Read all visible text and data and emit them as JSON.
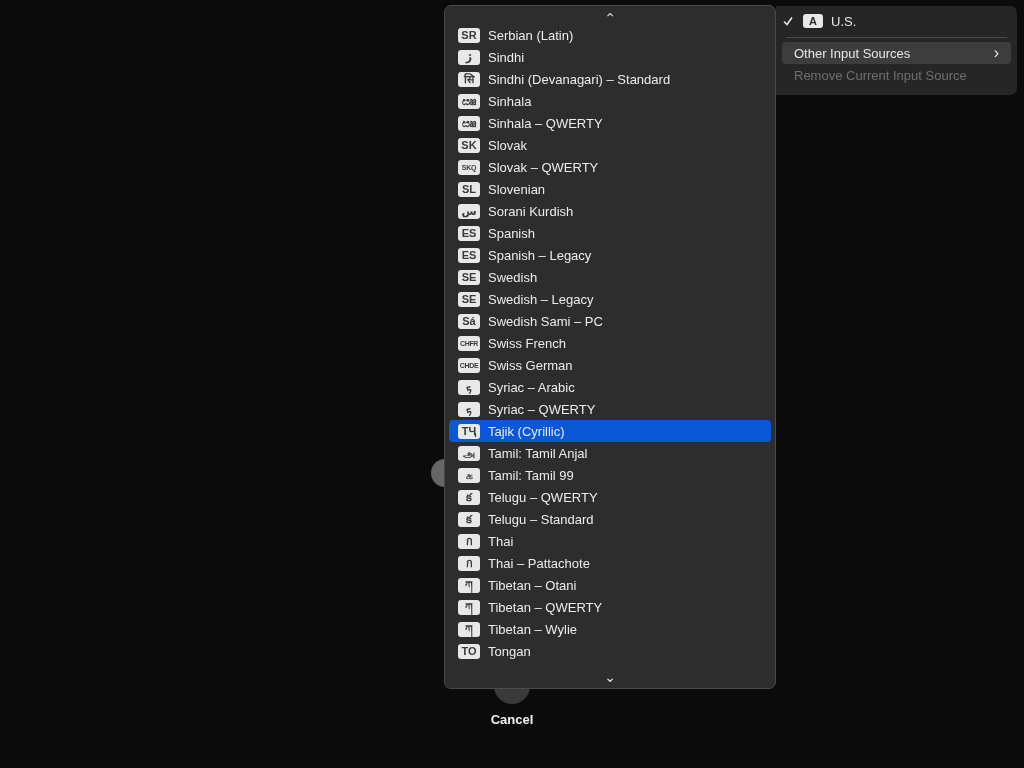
{
  "language_menu": {
    "scroll_up": "⌃",
    "scroll_down": "⌄",
    "items": [
      {
        "badge": "SR",
        "label": "Serbian (Latin)",
        "selected": false
      },
      {
        "badge": "ڙ",
        "label": "Sindhi",
        "selected": false
      },
      {
        "badge": "सि",
        "label": "Sindhi (Devanagari) – Standard",
        "selected": false
      },
      {
        "badge": "ඎ",
        "label": "Sinhala",
        "selected": false
      },
      {
        "badge": "ඎ",
        "label": "Sinhala – QWERTY",
        "selected": false
      },
      {
        "badge": "SK",
        "label": "Slovak",
        "selected": false
      },
      {
        "badge": "SKQ",
        "label": "Slovak – QWERTY",
        "selected": false
      },
      {
        "badge": "SL",
        "label": "Slovenian",
        "selected": false
      },
      {
        "badge": "س",
        "label": "Sorani Kurdish",
        "selected": false
      },
      {
        "badge": "ES",
        "label": "Spanish",
        "selected": false
      },
      {
        "badge": "ES",
        "label": "Spanish – Legacy",
        "selected": false
      },
      {
        "badge": "SE",
        "label": "Swedish",
        "selected": false
      },
      {
        "badge": "SE",
        "label": "Swedish – Legacy",
        "selected": false
      },
      {
        "badge": "Sá",
        "label": "Swedish Sami – PC",
        "selected": false
      },
      {
        "badge": "CHFR",
        "label": "Swiss French",
        "selected": false
      },
      {
        "badge": "CHDE",
        "label": "Swiss German",
        "selected": false
      },
      {
        "badge": "ܟ",
        "label": "Syriac – Arabic",
        "selected": false
      },
      {
        "badge": "ܟ",
        "label": "Syriac – QWERTY",
        "selected": false
      },
      {
        "badge": "ТҶ",
        "label": "Tajik (Cyrillic)",
        "selected": true
      },
      {
        "badge": "அ",
        "label": "Tamil: Tamil Anjal",
        "selected": false
      },
      {
        "badge": "க",
        "label": "Tamil: Tamil 99",
        "selected": false
      },
      {
        "badge": "క",
        "label": "Telugu – QWERTY",
        "selected": false
      },
      {
        "badge": "క",
        "label": "Telugu – Standard",
        "selected": false
      },
      {
        "badge": "ก",
        "label": "Thai",
        "selected": false
      },
      {
        "badge": "ก",
        "label": "Thai – Pattachote",
        "selected": false
      },
      {
        "badge": "ཀ",
        "label": "Tibetan – Otani",
        "selected": false
      },
      {
        "badge": "ཀ",
        "label": "Tibetan – QWERTY",
        "selected": false
      },
      {
        "badge": "ཀ",
        "label": "Tibetan – Wylie",
        "selected": false
      },
      {
        "badge": "TO",
        "label": "Tongan",
        "selected": false
      }
    ]
  },
  "input_menu": {
    "items": [
      {
        "kind": "source",
        "badge": "A",
        "label": "U.S.",
        "checked": true
      },
      {
        "kind": "separator"
      },
      {
        "kind": "submenu",
        "label": "Other Input Sources",
        "arrow": "›",
        "selected": true
      },
      {
        "kind": "action",
        "label": "Remove Current Input Source",
        "disabled": true
      }
    ]
  },
  "cancel_button": {
    "label": "Cancel"
  }
}
